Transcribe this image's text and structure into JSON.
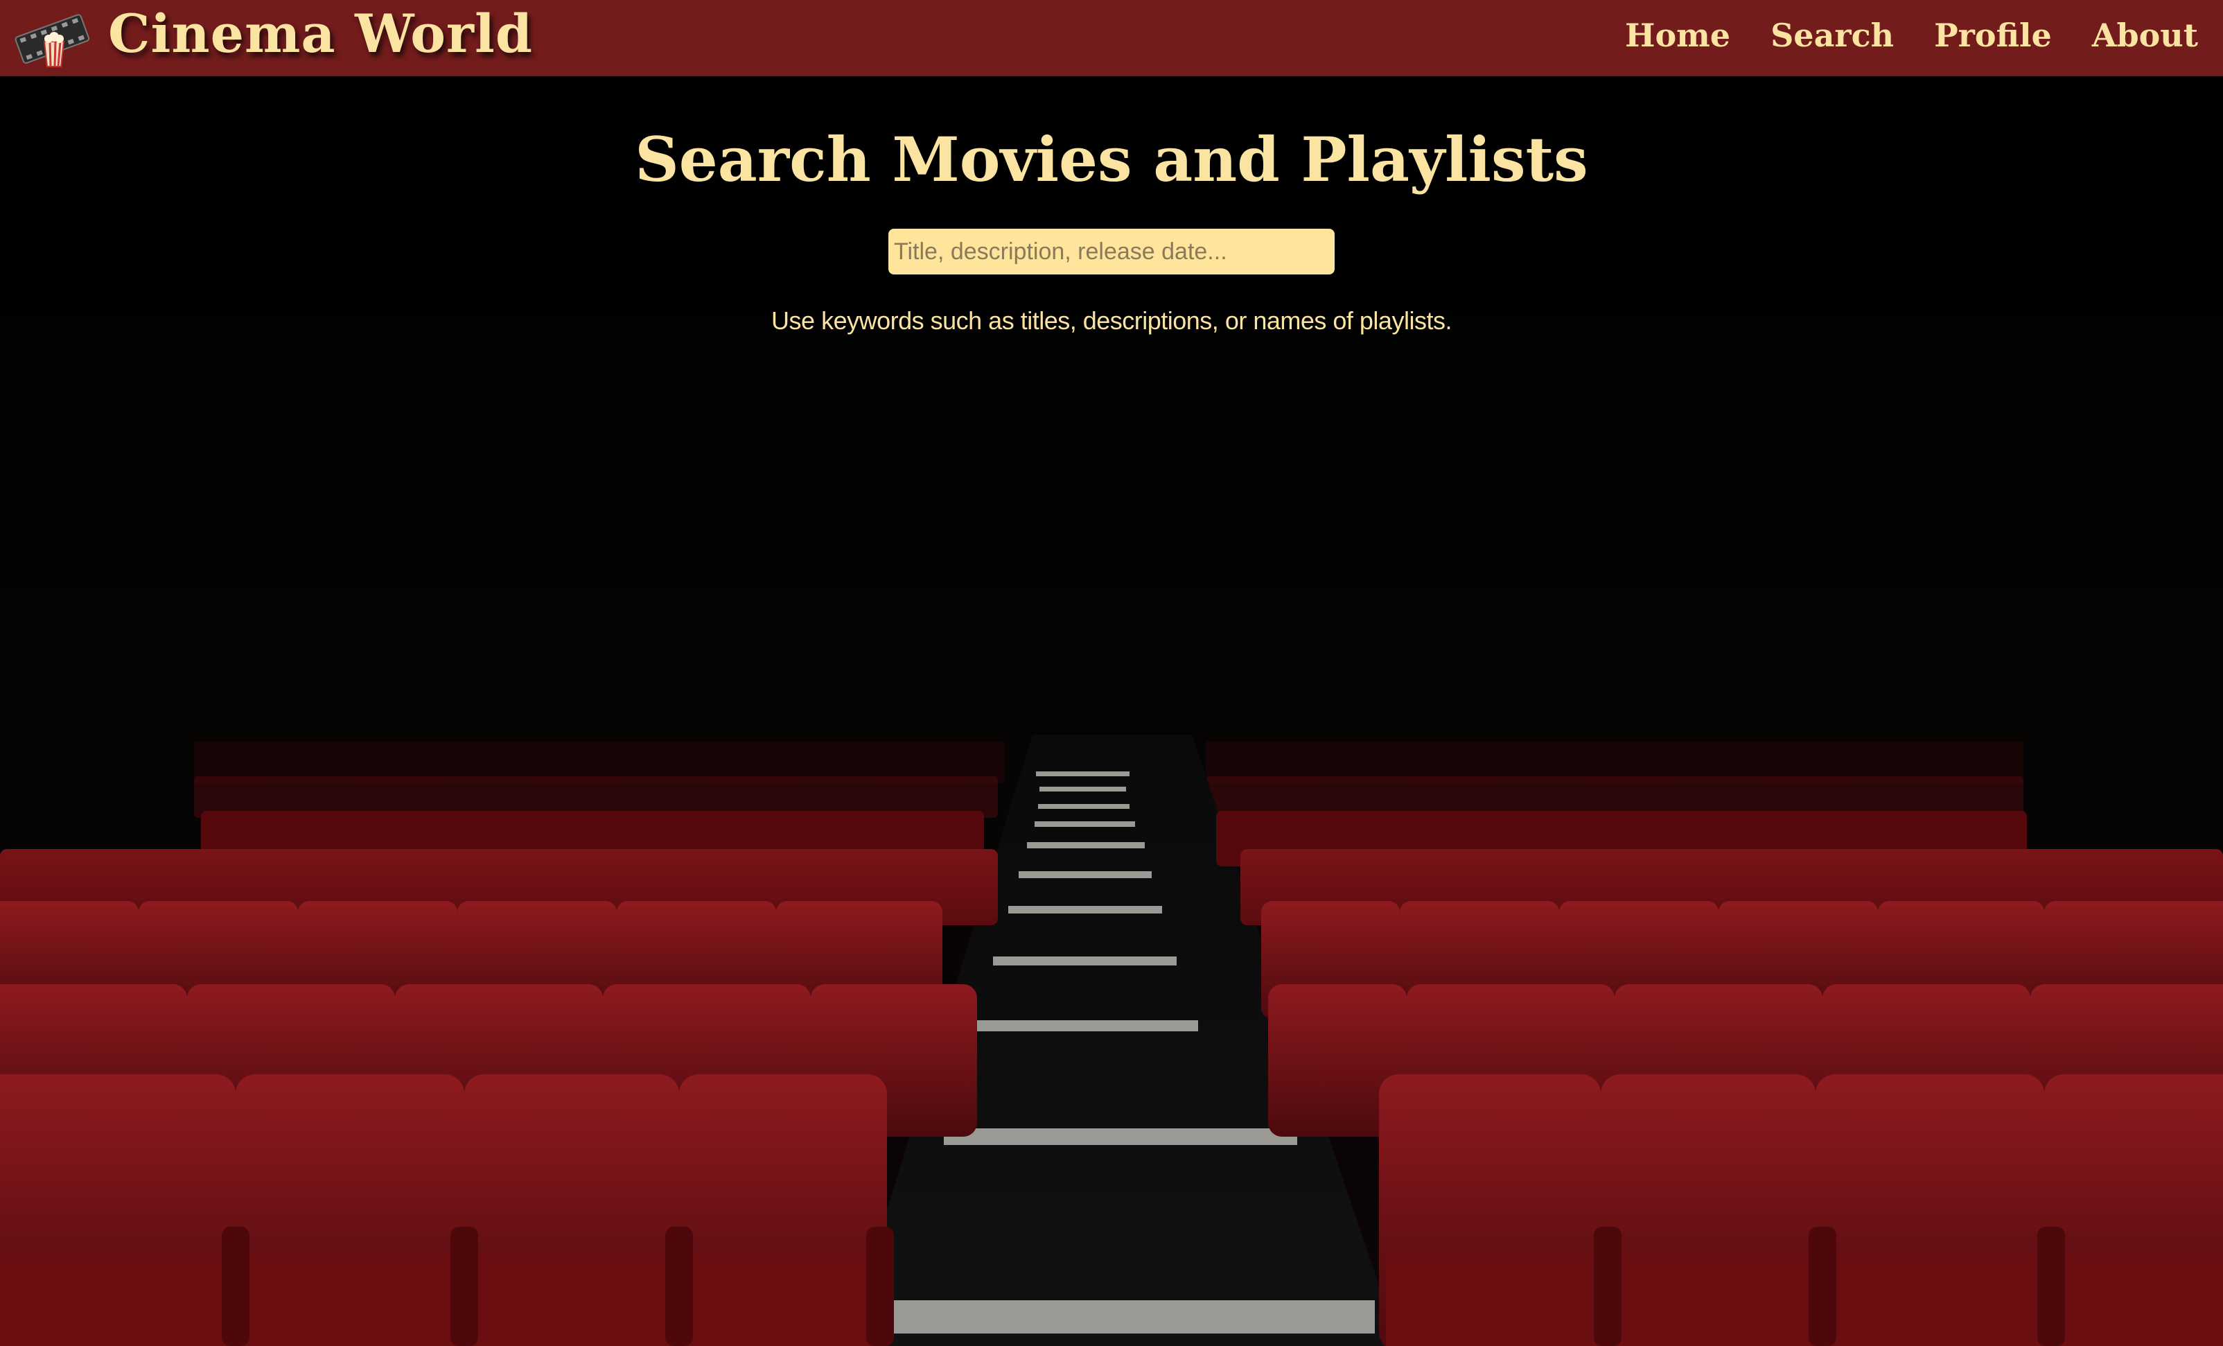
{
  "header": {
    "brand": "Cinema World",
    "logo_icon": "film-reel-popcorn-icon",
    "nav": [
      {
        "label": "Home"
      },
      {
        "label": "Search"
      },
      {
        "label": "Profile"
      },
      {
        "label": "About"
      }
    ]
  },
  "main": {
    "title": "Search Movies and Playlists",
    "search": {
      "value": "",
      "placeholder": "Title, description, release date..."
    },
    "hint": "Use keywords such as titles, descriptions, or names of playlists."
  },
  "colors": {
    "header_bg": "#731c1c",
    "accent_text": "#fbe3a2",
    "input_bg": "#ffe49c",
    "seat_red": "#7a1016"
  }
}
